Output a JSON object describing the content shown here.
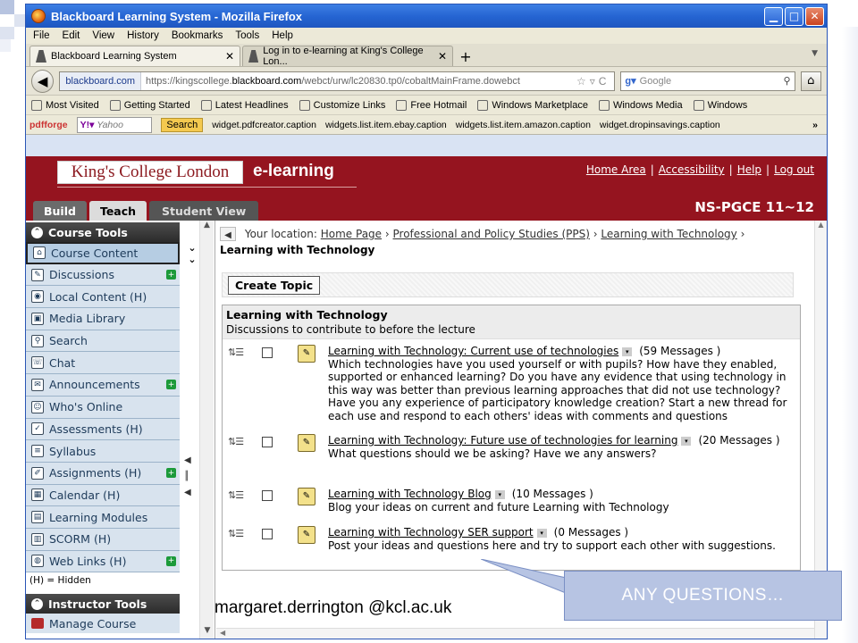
{
  "browser": {
    "title": "Blackboard Learning System - Mozilla Firefox",
    "menu": [
      "File",
      "Edit",
      "View",
      "History",
      "Bookmarks",
      "Tools",
      "Help"
    ],
    "tabs": [
      {
        "label": "Blackboard Learning System"
      },
      {
        "label": "Log in to e-learning at King's College Lon..."
      }
    ],
    "site_identity": "blackboard.com",
    "url_prefix": "https://kingscollege.",
    "url_domain": "blackboard.com",
    "url_suffix": "/webct/urw/lc20830.tp0/cobaltMainFrame.dowebct",
    "search_placeholder": "Google",
    "bookmarks": [
      "Most Visited",
      "Getting Started",
      "Latest Headlines",
      "Customize Links",
      "Free Hotmail",
      "Windows Marketplace",
      "Windows Media",
      "Windows"
    ],
    "toolbar": {
      "pdfforge": "pdfforge",
      "yahoo_label": "Yahoo",
      "search_button": "Search",
      "widgets": [
        "widget.pdfcreator.caption",
        "widgets.list.item.ebay.caption",
        "widgets.list.item.amazon.caption",
        "widget.dropinsavings.caption"
      ]
    }
  },
  "bb": {
    "institution": "King's College London",
    "product": "e-learning",
    "links": [
      "Home Area",
      "Accessibility",
      "Help",
      "Log out"
    ],
    "tabs": [
      "Build",
      "Teach",
      "Student View"
    ],
    "active_tab": "Teach",
    "course_code": "NS-PGCE 11~12",
    "course_tools_header": "Course Tools",
    "course_tools": [
      {
        "label": "Course Content",
        "selected": true
      },
      {
        "label": "Discussions",
        "plus": true
      },
      {
        "label": "Local Content (H)"
      },
      {
        "label": "Media Library"
      },
      {
        "label": "Search"
      },
      {
        "label": "Chat"
      },
      {
        "label": "Announcements",
        "plus": true
      },
      {
        "label": "Who's Online"
      },
      {
        "label": "Assessments (H)"
      },
      {
        "label": "Syllabus"
      },
      {
        "label": "Assignments (H)",
        "plus": true
      },
      {
        "label": "Calendar (H)"
      },
      {
        "label": "Learning Modules"
      },
      {
        "label": "SCORM (H)"
      },
      {
        "label": "Web Links (H)",
        "plus": true
      }
    ],
    "hidden_note": "(H) = Hidden",
    "instructor_tools_header": "Instructor Tools",
    "manage_course": "Manage Course",
    "location_label": "Your location:",
    "breadcrumbs": [
      "Home Page",
      "Professional and Policy Studies (PPS)",
      "Learning with Technology"
    ],
    "current_page": "Learning with Technology",
    "create_topic": "Create Topic",
    "discussion_title": "Learning with Technology",
    "discussion_description": "Discussions to contribute to before the lecture",
    "topics": [
      {
        "title": "Learning with Technology: Current use of technologies",
        "count": "(59 Messages )",
        "description": "Which technologies have you used yourself or with pupils? How have they enabled, supported or enhanced learning? Do you have any evidence that using technology in this way was better than previous learning approaches that did not use technology? Have you any experience of participatory knowledge creation? Start a new thread for each use and respond to each others' ideas with comments and questions"
      },
      {
        "title": "Learning with Technology: Future use of technologies for learning",
        "count": "(20 Messages )",
        "description": "What questions should we be asking? Have we any answers?"
      },
      {
        "title": "Learning with Technology Blog",
        "count": "(10 Messages )",
        "description": "Blog your ideas on current and future Learning with Technology"
      },
      {
        "title": "Learning with Technology SER support",
        "count": "(0 Messages )",
        "description": "Post your ideas and questions here and try to support each other with suggestions."
      }
    ]
  },
  "slide": {
    "callout": "ANY QUESTIONS…",
    "email": "margaret.derrington @kcl.ac.uk"
  }
}
